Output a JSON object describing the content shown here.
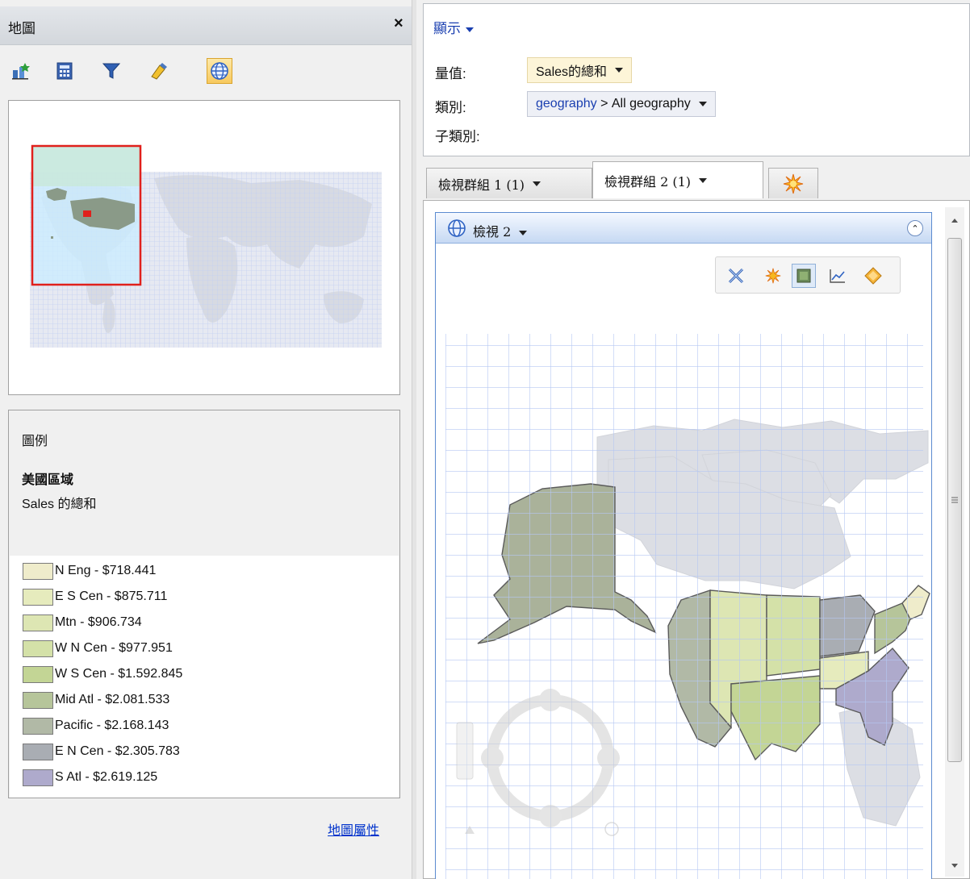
{
  "left_pane": {
    "title": "地圖",
    "close_glyph": "×",
    "toolbar_icons": [
      "dataset-icon",
      "calculator-icon",
      "filter-icon",
      "highlight-icon",
      "map-view-icon"
    ],
    "legend": {
      "title": "圖例",
      "layer": "美國區域",
      "measure": "Sales 的總和",
      "items": [
        {
          "label": "N Eng - $718.441",
          "color": "#efeccb"
        },
        {
          "label": "E S Cen - $875.711",
          "color": "#e6ebbd"
        },
        {
          "label": "Mtn - $906.734",
          "color": "#dde6b3"
        },
        {
          "label": "W N Cen - $977.951",
          "color": "#d4e1a8"
        },
        {
          "label": "W S Cen - $1.592.845",
          "color": "#c3d595"
        },
        {
          "label": "Mid Atl - $2.081.533",
          "color": "#b6c59a"
        },
        {
          "label": "Pacific - $2.168.143",
          "color": "#b1b9a6"
        },
        {
          "label": "E N Cen - $2.305.783",
          "color": "#a9adb3"
        },
        {
          "label": "S Atl - $2.619.125",
          "color": "#aeaacc"
        }
      ]
    },
    "properties_link": "地圖屬性"
  },
  "right_pane": {
    "display_menu": "顯示",
    "fields": {
      "measure_label": "量值:",
      "measure_value": "Sales的總和",
      "category_label": "類別:",
      "category_link": "geography",
      "category_sep": ">",
      "category_value": "All geography",
      "subcategory_label": "子類別:"
    },
    "tabs": [
      {
        "label": "檢視群組 1 (1)",
        "active": false
      },
      {
        "label": "檢視群組 2 (1)",
        "active": true
      }
    ],
    "new_tab_icon": "new-tab-starburst-icon",
    "view": {
      "title": "檢視 2",
      "map_toolbar_icons": [
        "clear-selection-icon",
        "new-view-icon",
        "shaded-map-icon",
        "chart-icon",
        "pan-icon"
      ]
    }
  },
  "colors": {
    "accent_blue": "#1a3fb0",
    "selection_red": "#e0201c",
    "map_grid": "#b5c7f2",
    "land": "#dcdee4",
    "water": "#ffffff"
  }
}
